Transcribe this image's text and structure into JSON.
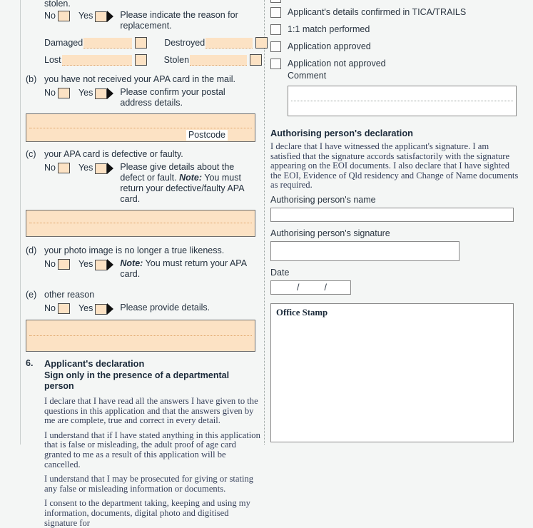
{
  "colors": {
    "page_background": "#f4f6f5",
    "field_fill": "#fce2c4",
    "field_border": "#6e6e6e",
    "dotted_rule": "#e0a569",
    "text": "#24313f"
  },
  "left_column": {
    "intro_tail": "stolen.",
    "answer_labels": {
      "no": "No",
      "yes": "Yes"
    },
    "reason_a": {
      "follow_text": "Please indicate the reason for replacement.",
      "options": [
        {
          "label": "Damaged"
        },
        {
          "label": "Destroyed"
        },
        {
          "label": "Lost"
        },
        {
          "label": "Stolen"
        }
      ]
    },
    "reason_b": {
      "letter": "(b)",
      "title": "you have not received your APA card in the mail.",
      "follow_text": "Please confirm your postal address details.",
      "postcode_label": "Postcode"
    },
    "reason_c": {
      "letter": "(c)",
      "title": "your APA card is defective or faulty.",
      "follow_lead": "Please give details about the defect or fault. ",
      "follow_note": "Note:",
      "follow_tail": " You must return your defective/faulty APA card."
    },
    "reason_d": {
      "letter": "(d)",
      "title": "your photo image is no longer a true likeness.",
      "follow_note": "Note:",
      "follow_tail": " You must return your APA card."
    },
    "reason_e": {
      "letter": "(e)",
      "title": "other reason",
      "follow_text": "Please provide details."
    },
    "applicant_declaration": {
      "number": "6.",
      "heading": "Applicant's declaration",
      "subheading": "Sign only in the presence of a departmental person",
      "paragraphs": [
        "I declare that I have read all the answers I have given to the questions in this application and that the answers given by me are complete, true and correct in every detail.",
        "I understand that if I have stated anything in this application that is false or misleading, the adult proof of age card granted to me as a result of this application will be cancelled.",
        "I understand that I may be prosecuted for giving or stating any false or misleading information or documents.",
        "I consent to the department taking, keeping and using my information, documents, digital photo and digitised signature for"
      ]
    }
  },
  "right_column": {
    "checklist": [
      {
        "label": "Applicant's details confirmed in TICA/TRAILS"
      },
      {
        "label": "1:1 match performed"
      },
      {
        "label": "Application approved"
      },
      {
        "label": "Application not approved"
      }
    ],
    "comment_label": "Comment",
    "authorising": {
      "heading": "Authorising person's declaration",
      "body": "I declare that I have witnessed the applicant's signature. I am satisfied that the signature accords satisfactorily with the signature appearing on the EOI documents. I also declare that I have sighted the EOI, Evidence of Qld residency and Change of Name documents as required.",
      "name_label": "Authorising person's name",
      "signature_label": "Authorising person's signature",
      "date_label": "Date",
      "date_separator": "/"
    },
    "office_stamp_label": "Office Stamp"
  }
}
